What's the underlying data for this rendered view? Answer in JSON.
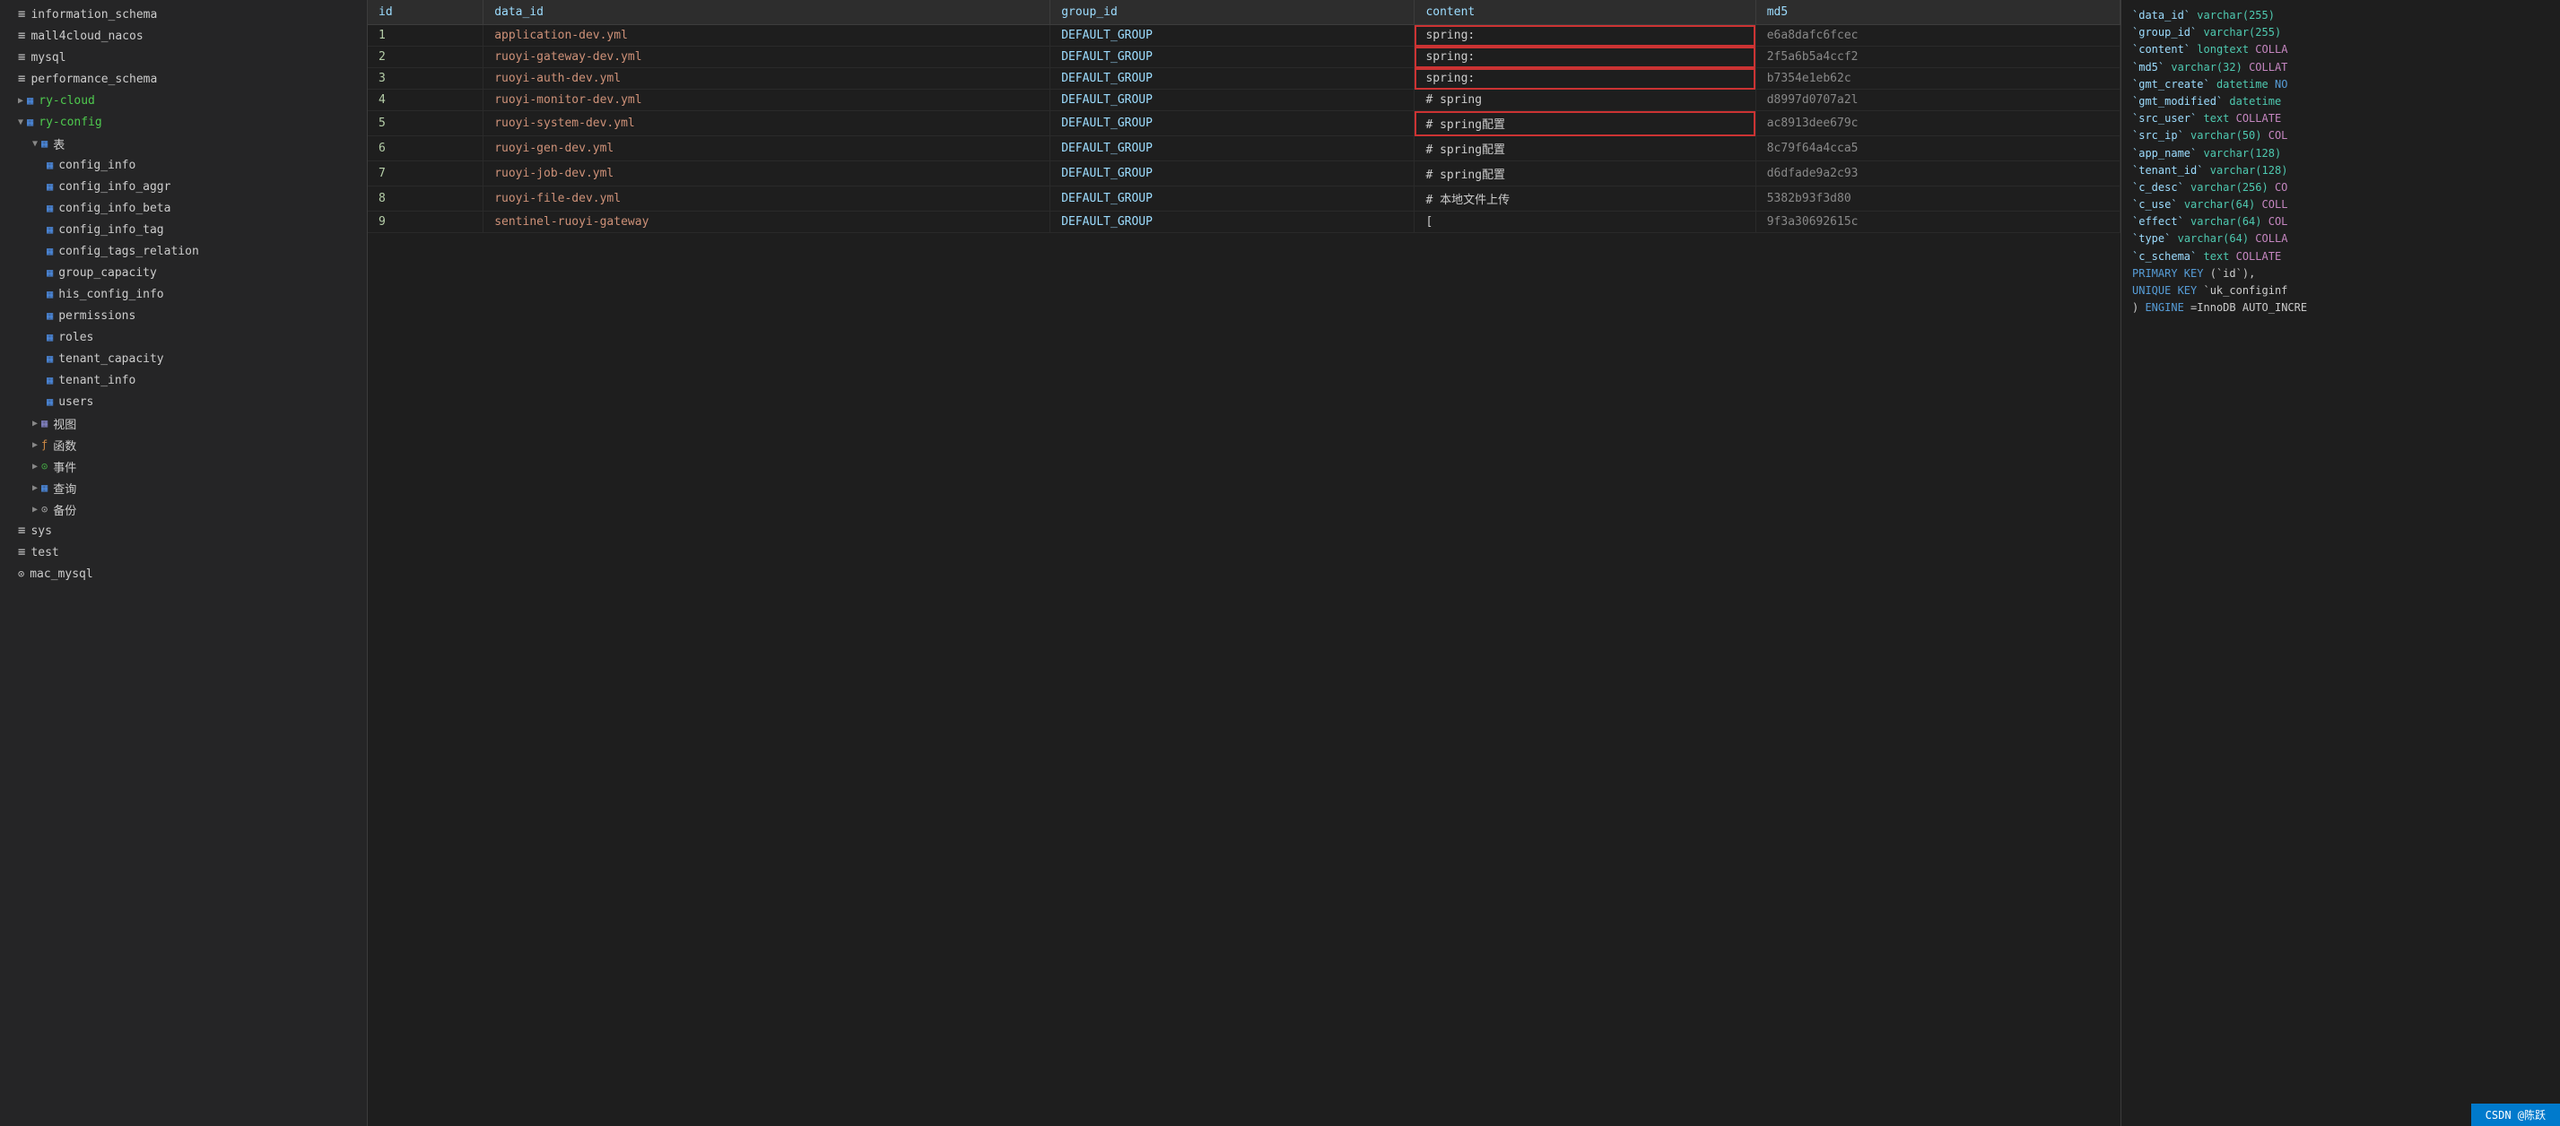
{
  "sidebar": {
    "databases": [
      {
        "name": "information_schema",
        "type": "db",
        "expanded": false
      },
      {
        "name": "mall4cloud_nacos",
        "type": "db",
        "expanded": false
      },
      {
        "name": "mysql",
        "type": "db",
        "expanded": false
      },
      {
        "name": "performance_schema",
        "type": "db",
        "expanded": false
      },
      {
        "name": "ry-cloud",
        "type": "db",
        "expanded": true,
        "green": true
      },
      {
        "name": "ry-config",
        "type": "db",
        "expanded": true,
        "green": true
      }
    ],
    "ry_config_items": {
      "tables_label": "表",
      "tables": [
        "config_info",
        "config_info_aggr",
        "config_info_beta",
        "config_info_tag",
        "config_tags_relation",
        "group_capacity",
        "his_config_info",
        "permissions",
        "roles",
        "tenant_capacity",
        "tenant_info",
        "users"
      ],
      "views_label": "视图",
      "functions_label": "函数",
      "events_label": "事件",
      "queries_label": "查询",
      "backups_label": "备份"
    },
    "other_dbs": [
      {
        "name": "sys",
        "type": "db"
      },
      {
        "name": "test",
        "type": "db"
      },
      {
        "name": "mac_mysql",
        "type": "db"
      }
    ]
  },
  "table": {
    "columns": [
      "id",
      "data_id",
      "group_id",
      "content",
      "md5"
    ],
    "rows": [
      {
        "id": "1",
        "data_id": "application-dev.yml",
        "group_id": "DEFAULT_GROUP",
        "content": "spring:",
        "md5": "e6a8dafc6fcec"
      },
      {
        "id": "2",
        "data_id": "ruoyi-gateway-dev.yml",
        "group_id": "DEFAULT_GROUP",
        "content": "spring:",
        "md5": "2f5a6b5a4ccf2"
      },
      {
        "id": "3",
        "data_id": "ruoyi-auth-dev.yml",
        "group_id": "DEFAULT_GROUP",
        "content": "spring:",
        "md5": "b7354e1eb62c"
      },
      {
        "id": "4",
        "data_id": "ruoyi-monitor-dev.yml",
        "group_id": "DEFAULT_GROUP",
        "content": "# spring",
        "md5": "d8997d0707a2l"
      },
      {
        "id": "5",
        "data_id": "ruoyi-system-dev.yml",
        "group_id": "DEFAULT_GROUP",
        "content": "# spring配置",
        "md5": "ac8913dee679c"
      },
      {
        "id": "6",
        "data_id": "ruoyi-gen-dev.yml",
        "group_id": "DEFAULT_GROUP",
        "content": "# spring配置",
        "md5": "8c79f64a4cca5"
      },
      {
        "id": "7",
        "data_id": "ruoyi-job-dev.yml",
        "group_id": "DEFAULT_GROUP",
        "content": "# spring配置",
        "md5": "d6dfade9a2c93"
      },
      {
        "id": "8",
        "data_id": "ruoyi-file-dev.yml",
        "group_id": "DEFAULT_GROUP",
        "content": "# 本地文件上传",
        "md5": "5382b93f3d80"
      },
      {
        "id": "9",
        "data_id": "sentinel-ruoyi-gateway",
        "group_id": "DEFAULT_GROUP",
        "content": "[",
        "md5": "9f3a30692615c"
      }
    ]
  },
  "ddl": {
    "lines": [
      "`data_id` varchar(255)",
      "`group_id` varchar(255)",
      "`content` longtext COLLA",
      "`md5` varchar(32) COLLAT",
      "`gmt_create` datetime NO",
      "`gmt_modified` datetime",
      "`src_user` text COLLATE",
      "`src_ip` varchar(50) COL",
      "`app_name` varchar(128)",
      "`tenant_id` varchar(128)",
      "`c_desc` varchar(256) CO",
      "`c_use` varchar(64) COLL",
      "`effect` varchar(64) COL",
      "`type` varchar(64) COLLA",
      "`c_schema` text COLLATE",
      "PRIMARY KEY (`id`),",
      "UNIQUE KEY `uk_configinf",
      ") ENGINE=InnoDB AUTO_INCRE"
    ]
  },
  "status_bar": {
    "user": "CSDN @陈跃"
  }
}
